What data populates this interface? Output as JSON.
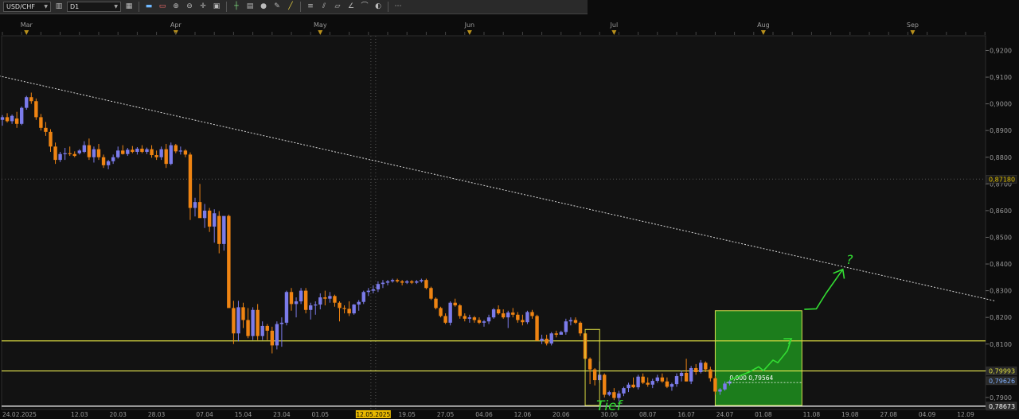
{
  "toolbar": {
    "symbol": "USD/CHF",
    "timeframe": "D1",
    "icons": [
      "chart-type-icon",
      "template-icon",
      "bar-chart-icon",
      "candle-chart-icon",
      "zoom-in-icon",
      "zoom-out-icon",
      "crosshair-icon",
      "tile-icon",
      "indicator-icon",
      "template-save-icon",
      "object-icon",
      "pen-icon",
      "trend-line-icon",
      "fibonacci-icon",
      "channel-icon",
      "shapes-icon",
      "text-icon",
      "marker-icon",
      "eraser-icon",
      "more-icon"
    ]
  },
  "chart_data": {
    "type": "candlestick",
    "symbol": "USD/CHF",
    "timeframe": "D1",
    "ylim": [
      0.7855,
      0.9255
    ],
    "y_ticks": [
      "0,9200",
      "0,9100",
      "0,9000",
      "0,8900",
      "0,8800",
      "0,8700",
      "0,8600",
      "0,8500",
      "0,8400",
      "0,8300",
      "0,8200",
      "0,8100",
      "0,8000",
      "0,7900"
    ],
    "y_tick_values": [
      0.92,
      0.91,
      0.9,
      0.89,
      0.88,
      0.87,
      0.86,
      0.85,
      0.84,
      0.83,
      0.82,
      0.81,
      0.8,
      0.79
    ],
    "month_labels": [
      "Mar",
      "Apr",
      "May",
      "Jun",
      "Jul",
      "Aug",
      "Sep"
    ],
    "month_days": [
      5,
      36,
      66,
      97,
      127,
      158,
      189
    ],
    "date_labels": [
      "24.02.2025",
      "12.03",
      "20.03",
      "28.03",
      "07.04",
      "15.04",
      "23.04",
      "01.05",
      "12.05.2025",
      "19.05",
      "27.05",
      "04.06",
      "12.06",
      "20.06",
      "30.06",
      "08.07",
      "16.07",
      "24.07",
      "01.08",
      "11.08",
      "19.08",
      "27.08",
      "04.09",
      "12.09"
    ],
    "date_days": [
      0,
      16,
      24,
      32,
      42,
      50,
      58,
      66,
      77,
      84,
      92,
      100,
      108,
      116,
      126,
      134,
      142,
      150,
      158,
      168,
      176,
      184,
      192,
      200
    ],
    "highlight_date_index": 8,
    "grid": false,
    "price_labels": [
      {
        "text": "0,87180",
        "value": 0.8718,
        "bg": "#1b1b1b",
        "fg": "#e0c000"
      },
      {
        "text": "0,79993",
        "value": 0.79993,
        "bg": "#2a2a2a",
        "fg": "#e0e040"
      },
      {
        "text": "0,79626",
        "value": 0.79626,
        "bg": "#2a2a2a",
        "fg": "#7fb0ff"
      },
      {
        "text": "0,78673",
        "value": 0.78673,
        "bg": "#2a2a2a",
        "fg": "#ffffff"
      }
    ],
    "horizontal_lines": [
      {
        "value": 0.8112,
        "color": "#d8d840"
      },
      {
        "value": 0.79993,
        "color": "#e8e850"
      },
      {
        "value": 0.78673,
        "color": "#ffffff"
      }
    ],
    "trend_line": {
      "from": [
        -2,
        0.911
      ],
      "to": [
        206,
        0.8262
      ]
    },
    "vertical_marker_day": 77,
    "zone_label": "0,000 0,79564",
    "zone": {
      "day_from": 148,
      "day_to": 166,
      "y_top": 0.8225,
      "y_bottom": 0.787
    },
    "annotation_label": "Tief",
    "annotation_top_mark": "?",
    "annotation_box": {
      "day_from": 121,
      "day_to": 124,
      "y_top": 0.8155,
      "y_bottom": 0.787
    },
    "candles": [
      [
        0,
        0.894,
        0.8958,
        0.8918,
        0.895
      ],
      [
        1,
        0.895,
        0.8965,
        0.893,
        0.8935
      ],
      [
        2,
        0.8935,
        0.896,
        0.8925,
        0.8955
      ],
      [
        3,
        0.8945,
        0.897,
        0.891,
        0.8925
      ],
      [
        4,
        0.8925,
        0.899,
        0.892,
        0.8985
      ],
      [
        5,
        0.8985,
        0.903,
        0.8978,
        0.9025
      ],
      [
        6,
        0.9025,
        0.9042,
        0.9,
        0.901
      ],
      [
        7,
        0.901,
        0.902,
        0.894,
        0.895
      ],
      [
        8,
        0.895,
        0.8962,
        0.89,
        0.891
      ],
      [
        9,
        0.891,
        0.8932,
        0.888,
        0.8895
      ],
      [
        10,
        0.8895,
        0.8905,
        0.882,
        0.884
      ],
      [
        11,
        0.884,
        0.8855,
        0.8775,
        0.879
      ],
      [
        12,
        0.879,
        0.882,
        0.8782,
        0.8812
      ],
      [
        13,
        0.8812,
        0.8835,
        0.879,
        0.8815
      ],
      [
        14,
        0.8815,
        0.884,
        0.8805,
        0.8812
      ],
      [
        15,
        0.8812,
        0.8822,
        0.88,
        0.8805
      ],
      [
        16,
        0.8815,
        0.883,
        0.881,
        0.8825
      ],
      [
        17,
        0.882,
        0.886,
        0.8815,
        0.8845
      ],
      [
        18,
        0.8845,
        0.887,
        0.879,
        0.88
      ],
      [
        19,
        0.88,
        0.884,
        0.878,
        0.883
      ],
      [
        20,
        0.883,
        0.885,
        0.879,
        0.88
      ],
      [
        21,
        0.88,
        0.881,
        0.876,
        0.877
      ],
      [
        22,
        0.877,
        0.879,
        0.8755,
        0.8785
      ],
      [
        23,
        0.8785,
        0.881,
        0.8775,
        0.88
      ],
      [
        24,
        0.88,
        0.884,
        0.8795,
        0.8825
      ],
      [
        25,
        0.8825,
        0.8845,
        0.881,
        0.8812
      ],
      [
        26,
        0.8812,
        0.8835,
        0.8805,
        0.8828
      ],
      [
        27,
        0.8828,
        0.8842,
        0.8815,
        0.882
      ],
      [
        28,
        0.882,
        0.8838,
        0.881,
        0.8832
      ],
      [
        29,
        0.8832,
        0.8845,
        0.8815,
        0.882
      ],
      [
        30,
        0.882,
        0.8836,
        0.8812,
        0.883
      ],
      [
        31,
        0.883,
        0.8845,
        0.8798,
        0.8808
      ],
      [
        32,
        0.8808,
        0.8825,
        0.879,
        0.88
      ],
      [
        33,
        0.88,
        0.884,
        0.879,
        0.883
      ],
      [
        34,
        0.883,
        0.885,
        0.876,
        0.8775
      ],
      [
        35,
        0.8775,
        0.8855,
        0.877,
        0.8845
      ],
      [
        36,
        0.8845,
        0.885,
        0.8815,
        0.8822
      ],
      [
        37,
        0.8822,
        0.884,
        0.881,
        0.8825
      ],
      [
        38,
        0.8825,
        0.883,
        0.88,
        0.881
      ],
      [
        39,
        0.881,
        0.8818,
        0.8565,
        0.861
      ],
      [
        40,
        0.861,
        0.8648,
        0.8578,
        0.8632
      ],
      [
        41,
        0.8632,
        0.87,
        0.86,
        0.8572
      ],
      [
        42,
        0.8572,
        0.8625,
        0.8535,
        0.86
      ],
      [
        43,
        0.86,
        0.861,
        0.852,
        0.854
      ],
      [
        44,
        0.854,
        0.8605,
        0.848,
        0.859
      ],
      [
        45,
        0.858,
        0.8598,
        0.844,
        0.8475
      ],
      [
        46,
        0.8475,
        0.853,
        0.845,
        0.858
      ],
      [
        47,
        0.858,
        0.8585,
        0.8255,
        0.8235
      ],
      [
        48,
        0.8235,
        0.8262,
        0.81,
        0.814
      ],
      [
        49,
        0.814,
        0.8262,
        0.811,
        0.8238
      ],
      [
        50,
        0.8238,
        0.8255,
        0.816,
        0.819
      ],
      [
        51,
        0.819,
        0.8235,
        0.8122,
        0.813
      ],
      [
        52,
        0.813,
        0.8238,
        0.8115,
        0.8228
      ],
      [
        53,
        0.8228,
        0.825,
        0.8115,
        0.813
      ],
      [
        54,
        0.813,
        0.8185,
        0.8115,
        0.8168
      ],
      [
        55,
        0.8168,
        0.8175,
        0.8115,
        0.815
      ],
      [
        56,
        0.815,
        0.8165,
        0.8065,
        0.8095
      ],
      [
        57,
        0.8095,
        0.8185,
        0.808,
        0.8175
      ],
      [
        58,
        0.8175,
        0.82,
        0.809,
        0.818
      ],
      [
        59,
        0.818,
        0.83,
        0.817,
        0.8295
      ],
      [
        60,
        0.8295,
        0.831,
        0.8225,
        0.825
      ],
      [
        61,
        0.825,
        0.8275,
        0.82,
        0.826
      ],
      [
        62,
        0.826,
        0.831,
        0.825,
        0.83
      ],
      [
        63,
        0.83,
        0.831,
        0.8215,
        0.8228
      ],
      [
        64,
        0.8228,
        0.8255,
        0.8192,
        0.8245
      ],
      [
        65,
        0.8245,
        0.826,
        0.821,
        0.8248
      ],
      [
        66,
        0.8248,
        0.829,
        0.823,
        0.8275
      ],
      [
        67,
        0.8275,
        0.83,
        0.8245,
        0.827
      ],
      [
        68,
        0.827,
        0.8295,
        0.8255,
        0.828
      ],
      [
        69,
        0.828,
        0.8285,
        0.824,
        0.8255
      ],
      [
        70,
        0.8255,
        0.826,
        0.8185,
        0.8235
      ],
      [
        71,
        0.8235,
        0.8245,
        0.8215,
        0.8232
      ],
      [
        72,
        0.8232,
        0.826,
        0.8205,
        0.8215
      ],
      [
        73,
        0.8215,
        0.825,
        0.821,
        0.8248
      ],
      [
        74,
        0.8248,
        0.8265,
        0.8225,
        0.8258
      ],
      [
        75,
        0.8258,
        0.83,
        0.825,
        0.8295
      ],
      [
        76,
        0.8295,
        0.831,
        0.828,
        0.83
      ],
      [
        77,
        0.83,
        0.832,
        0.829,
        0.8305
      ],
      [
        78,
        0.8305,
        0.8335,
        0.8295,
        0.8325
      ],
      [
        79,
        0.8325,
        0.834,
        0.831,
        0.833
      ],
      [
        80,
        0.833,
        0.834,
        0.832,
        0.8335
      ],
      [
        81,
        0.8335,
        0.8345,
        0.833,
        0.834
      ],
      [
        82,
        0.834,
        0.8345,
        0.833,
        0.8335
      ],
      [
        83,
        0.8335,
        0.834,
        0.832,
        0.833
      ],
      [
        84,
        0.833,
        0.834,
        0.8325,
        0.8335
      ],
      [
        85,
        0.8335,
        0.834,
        0.8325,
        0.833
      ],
      [
        86,
        0.833,
        0.834,
        0.8325,
        0.8335
      ],
      [
        87,
        0.8335,
        0.8345,
        0.833,
        0.834
      ],
      [
        88,
        0.834,
        0.8345,
        0.8305,
        0.831
      ],
      [
        89,
        0.831,
        0.8315,
        0.8265,
        0.827
      ],
      [
        90,
        0.827,
        0.8275,
        0.823,
        0.8235
      ],
      [
        91,
        0.8235,
        0.824,
        0.82,
        0.8205
      ],
      [
        92,
        0.8205,
        0.8215,
        0.8175,
        0.818
      ],
      [
        93,
        0.818,
        0.826,
        0.817,
        0.8255
      ],
      [
        94,
        0.8255,
        0.827,
        0.824,
        0.8245
      ],
      [
        95,
        0.8245,
        0.825,
        0.8195,
        0.8205
      ],
      [
        96,
        0.8205,
        0.8215,
        0.8185,
        0.8195
      ],
      [
        97,
        0.8195,
        0.821,
        0.818,
        0.82
      ],
      [
        98,
        0.82,
        0.8205,
        0.818,
        0.819
      ],
      [
        99,
        0.819,
        0.82,
        0.8175,
        0.818
      ],
      [
        100,
        0.818,
        0.819,
        0.8165,
        0.8185
      ],
      [
        101,
        0.8185,
        0.821,
        0.8175,
        0.82
      ],
      [
        102,
        0.82,
        0.8235,
        0.8195,
        0.823
      ],
      [
        103,
        0.823,
        0.8245,
        0.821,
        0.8215
      ],
      [
        104,
        0.8215,
        0.823,
        0.8195,
        0.82
      ],
      [
        105,
        0.82,
        0.8225,
        0.816,
        0.8218
      ],
      [
        106,
        0.8218,
        0.8235,
        0.82,
        0.821
      ],
      [
        107,
        0.821,
        0.822,
        0.818,
        0.819
      ],
      [
        108,
        0.819,
        0.821,
        0.817,
        0.8182
      ],
      [
        109,
        0.8182,
        0.8225,
        0.8175,
        0.822
      ],
      [
        110,
        0.822,
        0.8228,
        0.8195,
        0.8205
      ],
      [
        111,
        0.8205,
        0.821,
        0.8125,
        0.8112
      ],
      [
        112,
        0.8112,
        0.8135,
        0.81,
        0.812
      ],
      [
        113,
        0.812,
        0.8135,
        0.8095,
        0.8102
      ],
      [
        114,
        0.8102,
        0.8145,
        0.8095,
        0.814
      ],
      [
        115,
        0.814,
        0.815,
        0.8125,
        0.8135
      ],
      [
        116,
        0.8135,
        0.815,
        0.814,
        0.8145
      ],
      [
        117,
        0.8145,
        0.8195,
        0.8135,
        0.8185
      ],
      [
        118,
        0.8185,
        0.82,
        0.817,
        0.819
      ],
      [
        119,
        0.819,
        0.82,
        0.8175,
        0.818
      ],
      [
        120,
        0.818,
        0.8185,
        0.813,
        0.814
      ],
      [
        121,
        0.814,
        0.8145,
        0.804,
        0.8045
      ],
      [
        122,
        0.8045,
        0.805,
        0.795,
        0.8005
      ],
      [
        123,
        0.8005,
        0.801,
        0.7945,
        0.7965
      ],
      [
        124,
        0.7965,
        0.8035,
        0.7955,
        0.7985
      ],
      [
        125,
        0.7985,
        0.799,
        0.79,
        0.791
      ],
      [
        126,
        0.791,
        0.7925,
        0.7905,
        0.792
      ],
      [
        127,
        0.792,
        0.7935,
        0.789,
        0.7898
      ],
      [
        128,
        0.7898,
        0.7925,
        0.7885,
        0.7915
      ],
      [
        129,
        0.7915,
        0.794,
        0.7905,
        0.7935
      ],
      [
        130,
        0.7935,
        0.7955,
        0.792,
        0.7948
      ],
      [
        131,
        0.7948,
        0.7975,
        0.7935,
        0.7938
      ],
      [
        132,
        0.7938,
        0.7985,
        0.793,
        0.7978
      ],
      [
        133,
        0.7978,
        0.799,
        0.795,
        0.7955
      ],
      [
        134,
        0.7955,
        0.7975,
        0.794,
        0.7948
      ],
      [
        135,
        0.7948,
        0.797,
        0.7935,
        0.7962
      ],
      [
        136,
        0.7962,
        0.7985,
        0.7955,
        0.7975
      ],
      [
        137,
        0.7975,
        0.799,
        0.7955,
        0.796
      ],
      [
        138,
        0.796,
        0.7975,
        0.7935,
        0.794
      ],
      [
        139,
        0.794,
        0.7955,
        0.7925,
        0.795
      ],
      [
        140,
        0.795,
        0.799,
        0.794,
        0.798
      ],
      [
        141,
        0.798,
        0.8,
        0.796,
        0.7992
      ],
      [
        142,
        0.7992,
        0.8045,
        0.796,
        0.796
      ],
      [
        143,
        0.796,
        0.8018,
        0.795,
        0.801
      ],
      [
        144,
        0.801,
        0.8025,
        0.7985,
        0.7995
      ],
      [
        145,
        0.7995,
        0.804,
        0.799,
        0.803
      ],
      [
        146,
        0.803,
        0.8035,
        0.7995,
        0.8005
      ],
      [
        147,
        0.8005,
        0.8015,
        0.796,
        0.7972
      ],
      [
        148,
        0.7972,
        0.798,
        0.791,
        0.7922
      ],
      [
        149,
        0.7922,
        0.7935,
        0.791,
        0.793
      ],
      [
        150,
        0.793,
        0.796,
        0.7925,
        0.7952
      ],
      [
        151,
        0.7952,
        0.7965,
        0.7945,
        0.796
      ]
    ]
  }
}
